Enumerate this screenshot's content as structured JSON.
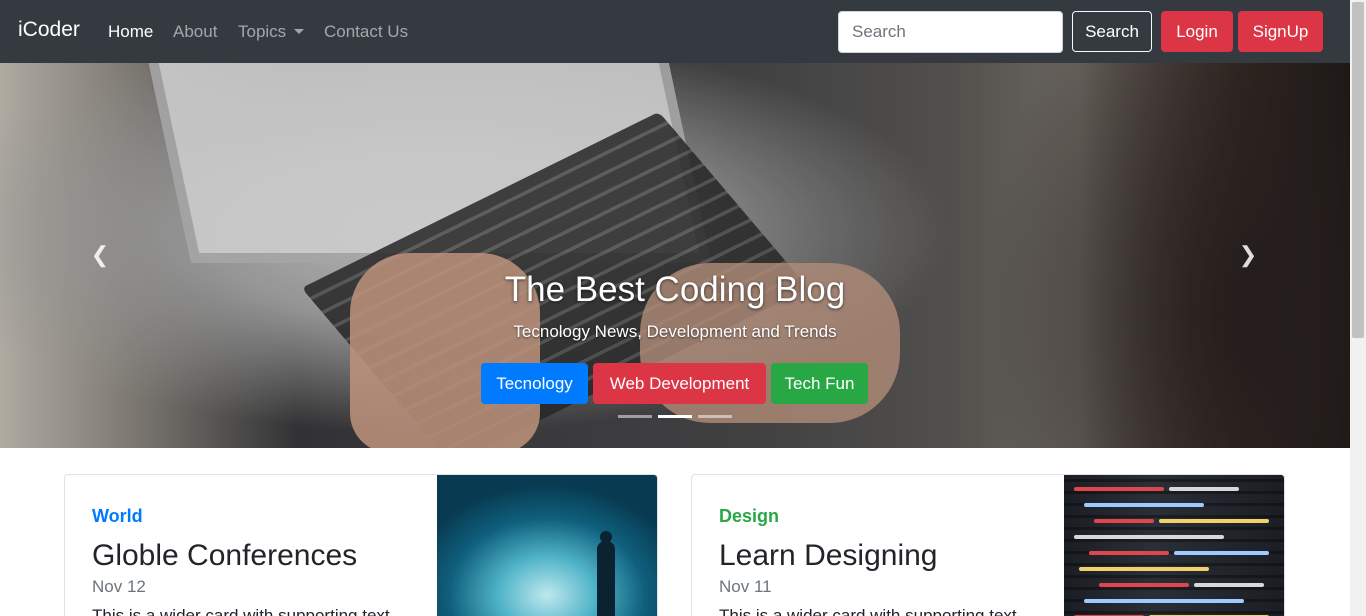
{
  "navbar": {
    "brand": "iCoder",
    "links": [
      {
        "label": "Home",
        "active": true
      },
      {
        "label": "About",
        "active": false
      },
      {
        "label": "Topics",
        "active": false,
        "dropdown": true
      },
      {
        "label": "Contact Us",
        "active": false
      }
    ],
    "search_placeholder": "Search",
    "search_button": "Search",
    "login_button": "Login",
    "signup_button": "SignUp"
  },
  "hero": {
    "title": "The Best Coding Blog",
    "subtitle": "Tecnology News, Development and Trends",
    "buttons": [
      "Tecnology",
      "Web Development",
      "Tech Fun"
    ],
    "active_slide": 2,
    "slide_count": 3
  },
  "cards": [
    {
      "category": "World",
      "title": "Globle Conferences",
      "date": "Nov 12",
      "text": "This is a wider card with supporting text"
    },
    {
      "category": "Design",
      "title": "Learn Designing",
      "date": "Nov 11",
      "text": "This is a wider card with supporting text"
    }
  ],
  "colors": {
    "navbar_bg": "#343a40",
    "primary": "#007bff",
    "danger": "#dc3545",
    "success": "#28a745"
  }
}
